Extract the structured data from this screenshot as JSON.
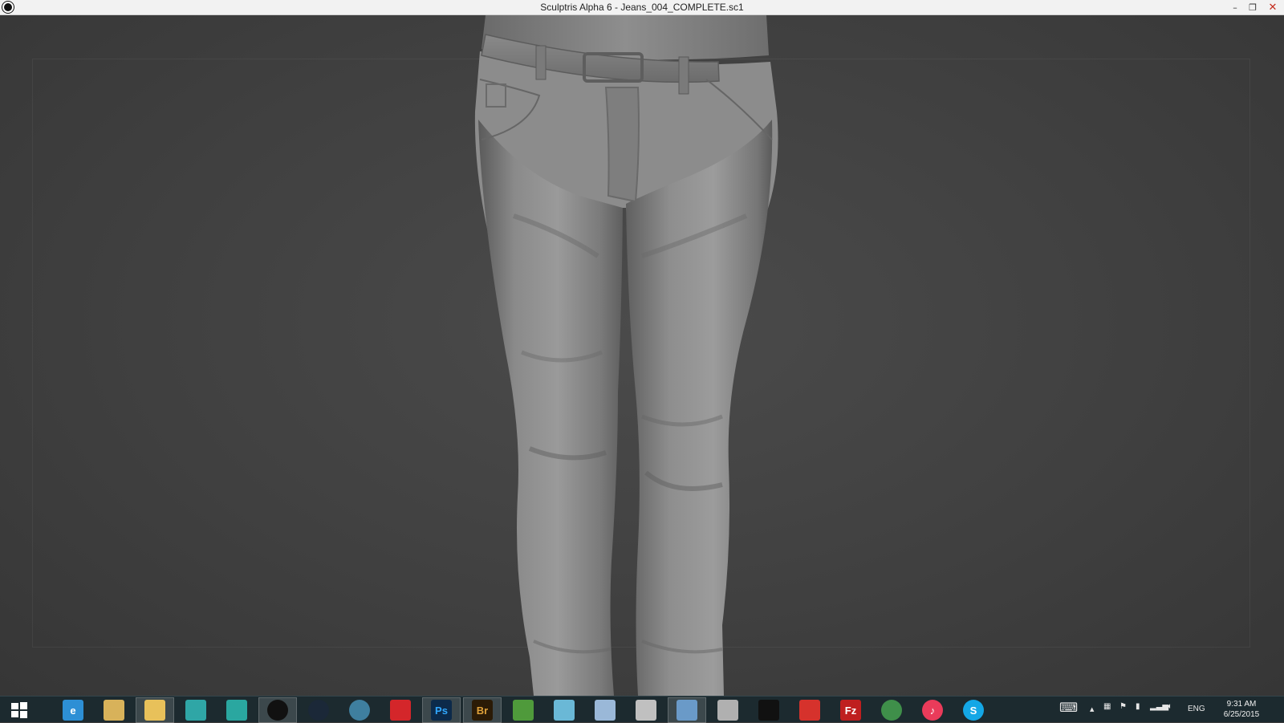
{
  "window": {
    "title": "Sculptris Alpha 6 - Jeans_004_COMPLETE.sc1",
    "app_icon": "sculptris-icon",
    "controls": {
      "minimize": "–",
      "restore": "❐",
      "close": "✕"
    }
  },
  "viewport": {
    "model": "jeans-sculpt",
    "background": "#444444"
  },
  "taskbar": {
    "background": "#1c2a2f",
    "apps": [
      {
        "name": "start-button",
        "icon": "windows-icon",
        "label": "",
        "active": false
      },
      {
        "name": "internet-explorer",
        "icon": "ie-icon",
        "label": "e",
        "active": false,
        "color": "#2d8fd5"
      },
      {
        "name": "outlook",
        "icon": "mail-icon",
        "label": "",
        "active": false,
        "color": "#d8b25a"
      },
      {
        "name": "file-explorer",
        "icon": "folder-icon",
        "label": "",
        "active": true,
        "color": "#e8c15a"
      },
      {
        "name": "maya-lt",
        "icon": "maya-lt-icon",
        "label": "",
        "active": false,
        "color": "#2fa6a6"
      },
      {
        "name": "mudbox",
        "icon": "mudbox-icon",
        "label": "",
        "active": false,
        "color": "#2aa7a0"
      },
      {
        "name": "sculptris",
        "icon": "sculptris-icon",
        "label": "",
        "active": true,
        "color": "#111111"
      },
      {
        "name": "steam",
        "icon": "steam-icon",
        "label": "",
        "active": false,
        "color": "#1b2838"
      },
      {
        "name": "blender-like",
        "icon": "globe-gear-icon",
        "label": "",
        "active": false,
        "color": "#3f7f9f"
      },
      {
        "name": "creative-cloud",
        "icon": "creative-cloud-icon",
        "label": "",
        "active": false,
        "color": "#d4262a"
      },
      {
        "name": "photoshop",
        "icon": "photoshop-icon",
        "label": "Ps",
        "active": true,
        "color": "#0c2a4a",
        "text_color": "#31a8ff"
      },
      {
        "name": "bridge",
        "icon": "bridge-icon",
        "label": "Br",
        "active": true,
        "color": "#2b1b06",
        "text_color": "#e0a23a"
      },
      {
        "name": "excel-like",
        "icon": "spreadsheet-icon",
        "label": "",
        "active": false,
        "color": "#4f9a3b"
      },
      {
        "name": "notes",
        "icon": "note-icon",
        "label": "",
        "active": false,
        "color": "#6ab8d6"
      },
      {
        "name": "calculator",
        "icon": "calculator-icon",
        "label": "",
        "active": false,
        "color": "#9ab8d8"
      },
      {
        "name": "paint-tool",
        "icon": "brush-icon",
        "label": "",
        "active": false,
        "color": "#c0c0c0"
      },
      {
        "name": "remote-desktop",
        "icon": "monitor-icon",
        "label": "",
        "active": true,
        "color": "#6a9ac8"
      },
      {
        "name": "image-viewer",
        "icon": "photo-icon",
        "label": "",
        "active": false,
        "color": "#b0b0b0"
      },
      {
        "name": "nvidia",
        "icon": "eye-icon",
        "label": "",
        "active": false,
        "color": "#111111"
      },
      {
        "name": "flash",
        "icon": "flash-icon",
        "label": "",
        "active": false,
        "color": "#d6322c"
      },
      {
        "name": "filezilla",
        "icon": "filezilla-icon",
        "label": "Fz",
        "active": false,
        "color": "#bf1f1f"
      },
      {
        "name": "earth",
        "icon": "earth-icon",
        "label": "",
        "active": false,
        "color": "#3f8f4a"
      },
      {
        "name": "itunes",
        "icon": "music-icon",
        "label": "♪",
        "active": false,
        "color": "#ea3b5a"
      },
      {
        "name": "skype",
        "icon": "skype-icon",
        "label": "S",
        "active": false,
        "color": "#14a7e6"
      }
    ]
  },
  "tray": {
    "keyboard_icon": "⌨",
    "chevron": "▲",
    "lang": "ENG",
    "time": "9:31 AM",
    "date": "6/25/2015"
  }
}
